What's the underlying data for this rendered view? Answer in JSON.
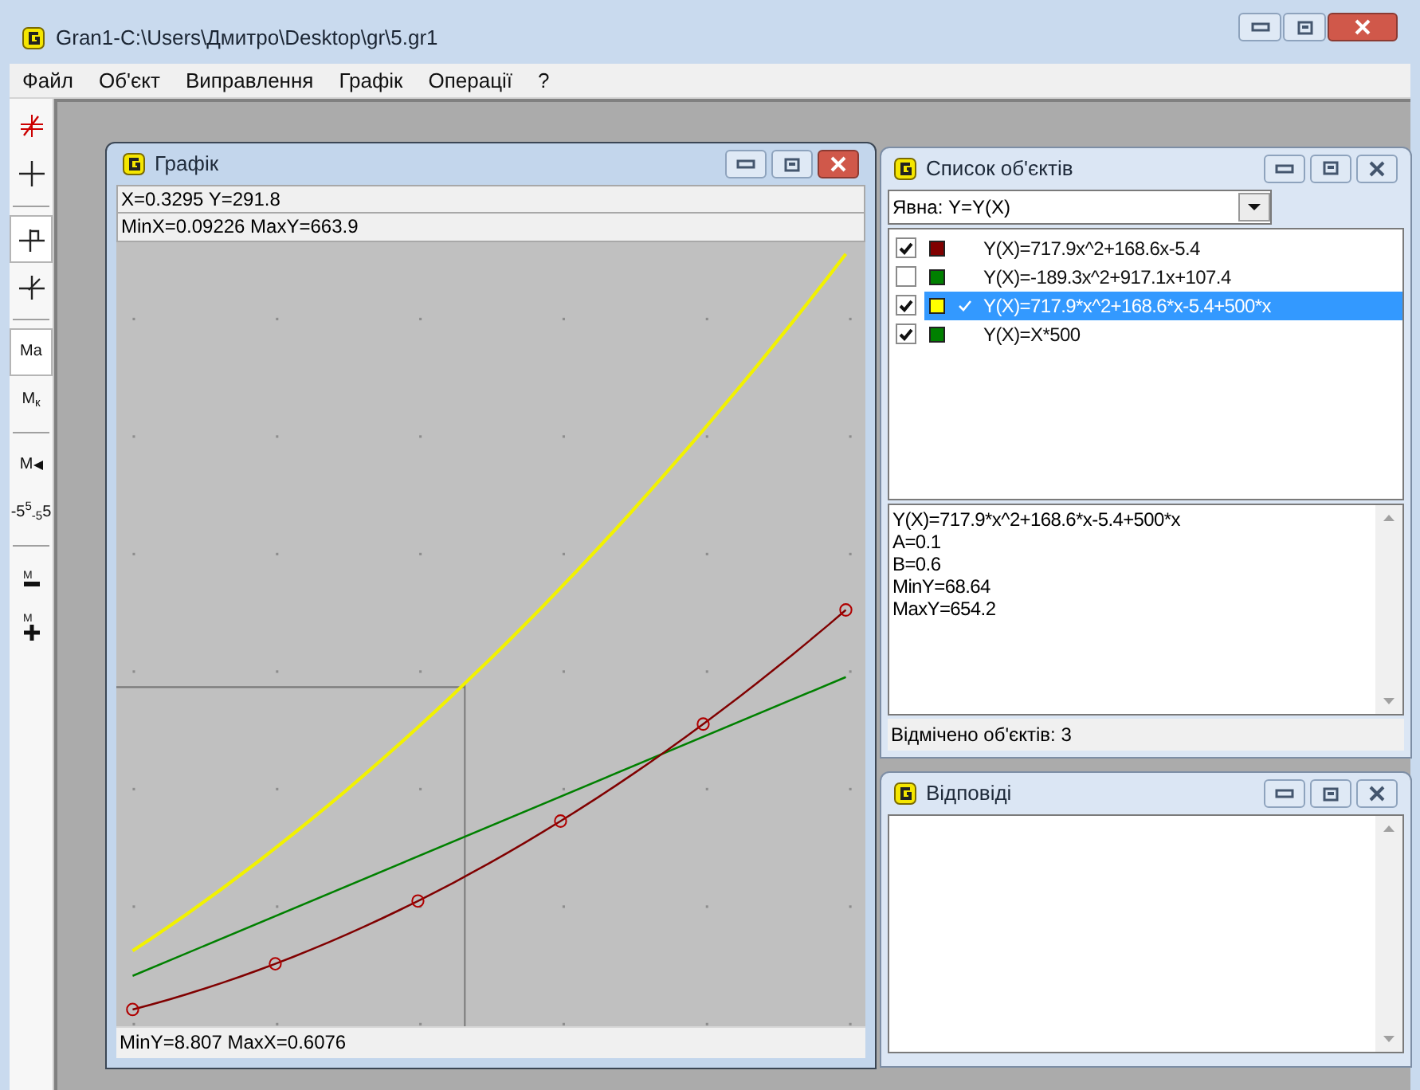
{
  "window": {
    "title": "Gran1-C:\\Users\\Дмитро\\Desktop\\gr\\5.gr1"
  },
  "menu": [
    "Файл",
    "Об'єкт",
    "Виправлення",
    "Графік",
    "Операції",
    "?"
  ],
  "toolbar": [
    {
      "kind": "cross-red",
      "selected": false
    },
    {
      "kind": "cross",
      "selected": false
    },
    {
      "kind": "separator"
    },
    {
      "kind": "cross-tick",
      "selected": true
    },
    {
      "kind": "cross-slash",
      "selected": false
    },
    {
      "kind": "separator"
    },
    {
      "kind": "text",
      "label": "Ma",
      "selected": true
    },
    {
      "kind": "text",
      "label": "M$_{к}$",
      "selected": false
    },
    {
      "kind": "separator"
    },
    {
      "kind": "text-arrow",
      "label": "M",
      "selected": false
    },
    {
      "kind": "text",
      "label": "-5$^{5}$$_{-5}$5",
      "selected": false
    },
    {
      "kind": "separator"
    },
    {
      "kind": "text-minus",
      "label": "M",
      "selected": false
    },
    {
      "kind": "text-plus",
      "label": "M",
      "selected": false
    }
  ],
  "graph_window": {
    "title": "Графік",
    "coords": "X=0.3295  Y=291.8",
    "range_top": "MinX=0.09226  MaxY=663.9",
    "range_bottom": "MinY=8.807  MaxX=0.6076"
  },
  "objects_window": {
    "title": "Список об'єктів",
    "type_select": "Явна: Y=Y(X)",
    "objects": [
      {
        "label": "Y(X)=717.9x^2+168.6x-5.4",
        "checked": true,
        "color": "#800000",
        "selected": false
      },
      {
        "label": "Y(X)=-189.3x^2+917.1x+107.4",
        "checked": false,
        "color": "#008000",
        "selected": false
      },
      {
        "label": "Y(X)=717.9*x^2+168.6*x-5.4+500*x",
        "checked": true,
        "color": "#ffff00",
        "selected": true
      },
      {
        "label": "Y(X)=X*500",
        "checked": true,
        "color": "#008000",
        "selected": false
      }
    ],
    "details": [
      "Y(X)=717.9*x^2+168.6*x-5.4+500*x",
      "A=0.1",
      "B=0.6",
      "MinY=68.64",
      "MaxY=654.2"
    ],
    "status": "Відмічено об'єктів: 3"
  },
  "answers_window": {
    "title": "Відповіді"
  }
}
